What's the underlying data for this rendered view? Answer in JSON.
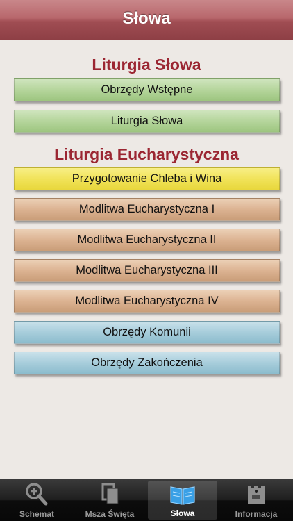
{
  "navbar": {
    "title": "Słowa"
  },
  "sections": [
    {
      "title": "Liturgia Słowa",
      "items": [
        {
          "label": "Obrzędy Wstępne",
          "color": "green"
        },
        {
          "label": "Liturgia Słowa",
          "color": "green"
        }
      ]
    },
    {
      "title": "Liturgia Eucharystyczna",
      "items": [
        {
          "label": "Przygotowanie Chleba i Wina",
          "color": "yellow"
        },
        {
          "label": "Modlitwa Eucharystyczna I",
          "color": "brown"
        },
        {
          "label": "Modlitwa Eucharystyczna II",
          "color": "brown"
        },
        {
          "label": "Modlitwa Eucharystyczna III",
          "color": "brown"
        },
        {
          "label": "Modlitwa Eucharystyczna IV",
          "color": "brown"
        },
        {
          "label": "Obrzędy Komunii",
          "color": "blue"
        },
        {
          "label": "Obrzędy Zakończenia",
          "color": "blue"
        }
      ]
    }
  ],
  "tabbar": {
    "tabs": [
      {
        "label": "Schemat",
        "icon": "magnifier-plus-icon",
        "active": false
      },
      {
        "label": "Msza Święta",
        "icon": "pages-icon",
        "active": false
      },
      {
        "label": "Słowa",
        "icon": "book-icon",
        "active": true
      },
      {
        "label": "Informacja",
        "icon": "castle-icon",
        "active": false
      }
    ]
  },
  "colors": {
    "section_title": "#9b2632",
    "navbar": "#a04d53",
    "background": "#ede9e5",
    "tab_active_icon": "#3aa0e6"
  }
}
